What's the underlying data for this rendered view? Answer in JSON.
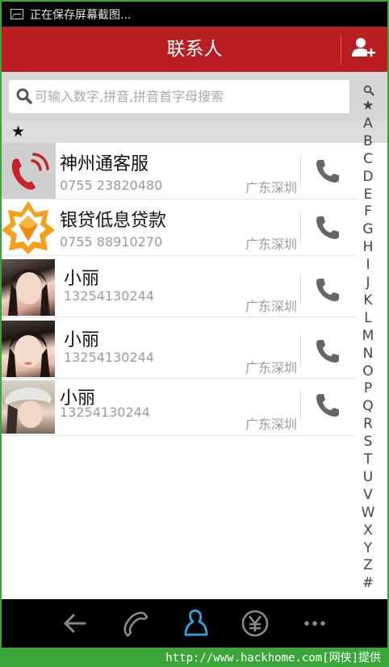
{
  "status_bar": {
    "icon": "screenshot-icon",
    "text": "正在保存屏幕截图..."
  },
  "header": {
    "title": "联系人",
    "add_icon": "add-contact-icon"
  },
  "search": {
    "placeholder": "可输入数字,拼音,拼音首字母搜索",
    "value": "",
    "icon": "search-icon"
  },
  "section": {
    "label": "★"
  },
  "contacts": [
    {
      "name": "神州通客服",
      "phone": "0755 23820480",
      "location": "广东深圳",
      "avatar": "red-phone-logo"
    },
    {
      "name": "银贷低息贷款",
      "phone": "0755 88910270",
      "location": "广东深圳",
      "avatar": "orange-star-logo"
    },
    {
      "name": "小丽",
      "phone": "13254130244",
      "location": "广东深圳",
      "avatar": "photo"
    },
    {
      "name": "小丽",
      "phone": "13254130244",
      "location": "广东深圳",
      "avatar": "photo"
    },
    {
      "name": "小丽",
      "phone": "13254130244",
      "location": "广东深圳",
      "avatar": "photo"
    }
  ],
  "alphabet": [
    "★",
    "A",
    "B",
    "C",
    "D",
    "E",
    "F",
    "G",
    "H",
    "I",
    "J",
    "K",
    "L",
    "M",
    "N",
    "O",
    "P",
    "Q",
    "R",
    "S",
    "T",
    "U",
    "V",
    "W",
    "X",
    "Y",
    "Z",
    "#"
  ],
  "bottom_nav": [
    "back-icon",
    "phone-icon",
    "contacts-icon",
    "yuan-icon",
    "more-icon"
  ],
  "footer": {
    "text": "http://www.hackhome.com[网侠]提供"
  },
  "colors": {
    "header": "#b81e22",
    "accent": "#2ea7e0",
    "footer": "#3aa63a"
  }
}
